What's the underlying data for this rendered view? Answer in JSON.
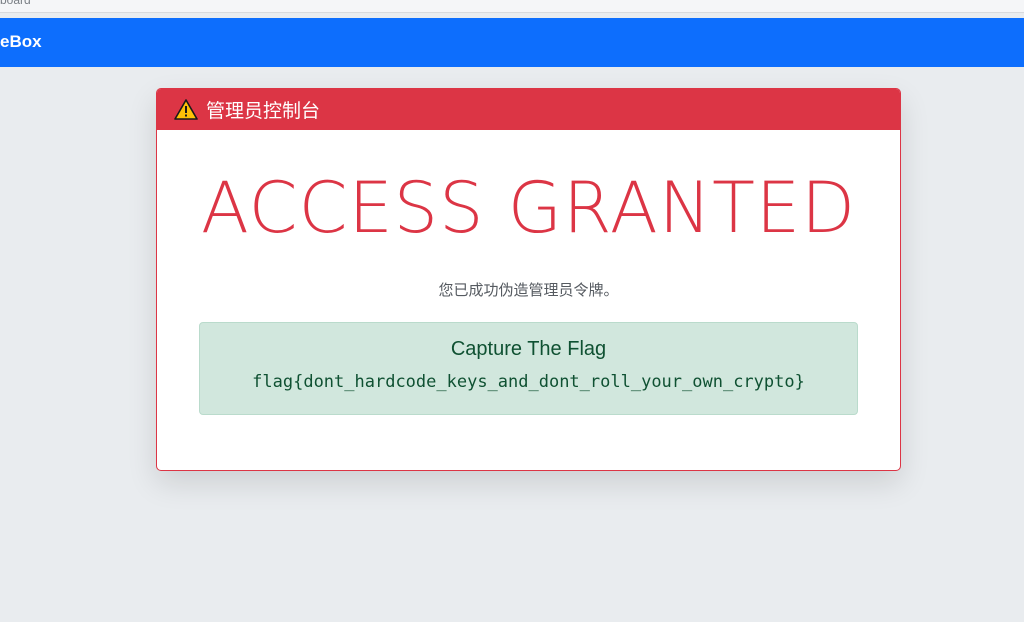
{
  "browser": {
    "partial_text": "board"
  },
  "navbar": {
    "brand": "eBox",
    "color": "#0d6efd"
  },
  "card": {
    "header_title": "管理员控制台",
    "header_icon": "warning-triangle-icon",
    "headline": "ACCESS GRANTED",
    "message": "您已成功伪造管理员令牌。",
    "flag": {
      "heading": "Capture The Flag",
      "value": "flag{dont_hardcode_keys_and_dont_roll_your_own_crypto}"
    }
  },
  "colors": {
    "danger": "#dc3545",
    "success_bg": "#d1e7dd",
    "success_text": "#0f5132",
    "page_bg": "#e9ecef"
  }
}
